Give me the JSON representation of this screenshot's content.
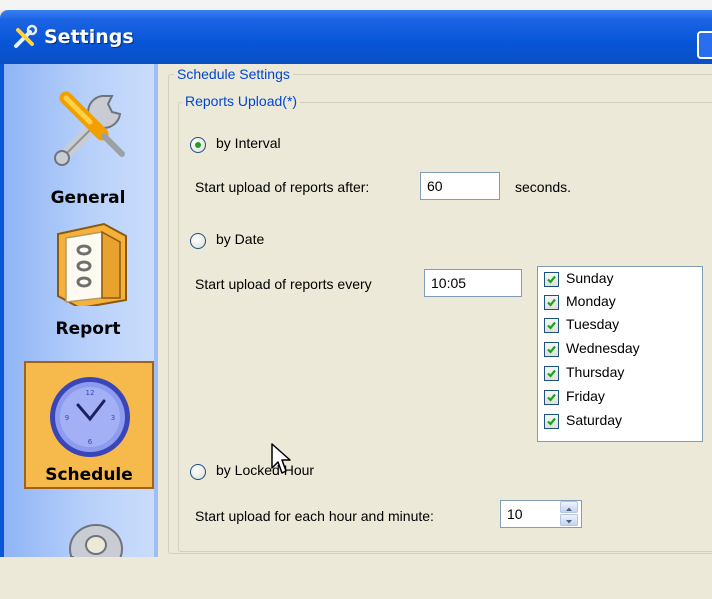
{
  "window": {
    "title": "Settings",
    "title_icon": "tools-icon"
  },
  "sidebar": {
    "items": [
      {
        "label": "General",
        "icon": "tools-icon",
        "selected": false
      },
      {
        "label": "Report",
        "icon": "binder-icon",
        "selected": false
      },
      {
        "label": "Schedule",
        "icon": "clock-icon",
        "selected": true
      },
      {
        "label": "",
        "icon": "key-icon",
        "selected": false
      }
    ]
  },
  "schedule": {
    "group_title": "Schedule Settings",
    "reports_upload": {
      "group_title": "Reports Upload(*)",
      "by_interval": {
        "label": "by Interval",
        "checked": true,
        "start_label": "Start upload of reports after:",
        "value": "60",
        "unit": "seconds."
      },
      "by_date": {
        "label": "by Date",
        "checked": false,
        "start_label": "Start upload of reports every",
        "value": "10:05",
        "days": [
          {
            "label": "Sunday",
            "checked": true
          },
          {
            "label": "Monday",
            "checked": true
          },
          {
            "label": "Tuesday",
            "checked": true
          },
          {
            "label": "Wednesday",
            "checked": true
          },
          {
            "label": "Thursday",
            "checked": true
          },
          {
            "label": "Friday",
            "checked": true
          },
          {
            "label": "Saturday",
            "checked": true
          }
        ]
      },
      "by_locked_hour": {
        "label": "by Locked Hour",
        "checked": false,
        "start_label": "Start upload for each hour and minute:",
        "value": "10"
      }
    }
  },
  "colors": {
    "titlebar": "#0756d8",
    "group_title": "#0046d5",
    "selected_nav": "#f6b94c",
    "check": "#21a121"
  }
}
